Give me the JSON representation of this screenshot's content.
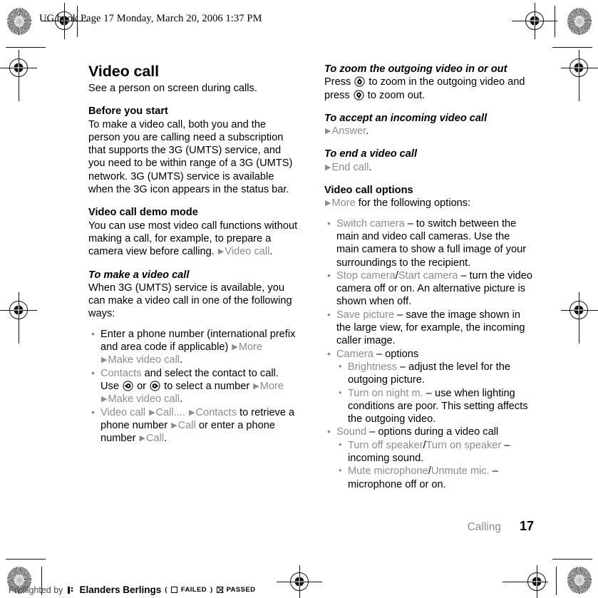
{
  "header": {
    "text": "UG.book  Page 17  Monday, March 20, 2006  1:37 PM"
  },
  "left_column": {
    "title": "Video call",
    "intro": "See a person on screen during calls.",
    "section_before": {
      "heading": "Before you start",
      "body": "To make a video call, both you and the person you are calling need a subscription that supports the 3G (UMTS) service, and you need to be within range of a 3G (UMTS) network. 3G (UMTS) service is available when the 3G icon appears in the status bar."
    },
    "section_demo": {
      "heading": "Video call demo mode",
      "body": "You can use most video call functions without making a call, for example, to prepare a camera view before calling.",
      "path_arrow": "▶",
      "path_keyword": "Video call",
      "path_end": "."
    },
    "section_make": {
      "heading": "To make a video call",
      "body": "When 3G (UMTS) service is available, you can make a video call in one of the following ways:",
      "bullets": [
        {
          "id": "enter-number",
          "parts": [
            {
              "t": "Enter a phone number (international prefix and area code if applicable) ",
              "s": "plain"
            },
            {
              "t": "▶",
              "s": "arrow"
            },
            {
              "t": "More",
              "s": "kw"
            },
            {
              "t": " ",
              "s": "plain"
            },
            {
              "t": "▶",
              "s": "arrow"
            },
            {
              "t": "Make video call",
              "s": "kw"
            },
            {
              "t": ".",
              "s": "plain"
            }
          ]
        },
        {
          "id": "contacts",
          "parts": [
            {
              "t": "Contacts",
              "s": "kw"
            },
            {
              "t": " and select the contact to call. Use ",
              "s": "plain"
            },
            {
              "t": "nav-left-key",
              "s": "icon-left"
            },
            {
              "t": " or ",
              "s": "plain"
            },
            {
              "t": "nav-right-key",
              "s": "icon-right"
            },
            {
              "t": " to select a number ",
              "s": "plain"
            },
            {
              "t": "▶",
              "s": "arrow"
            },
            {
              "t": "More",
              "s": "kw"
            },
            {
              "t": " ",
              "s": "plain"
            },
            {
              "t": "▶",
              "s": "arrow"
            },
            {
              "t": "Make video call",
              "s": "kw"
            },
            {
              "t": ".",
              "s": "plain"
            }
          ]
        },
        {
          "id": "video-call-menu",
          "parts": [
            {
              "t": "Video call",
              "s": "kw"
            },
            {
              "t": " ",
              "s": "plain"
            },
            {
              "t": "▶",
              "s": "arrow"
            },
            {
              "t": "Call....",
              "s": "kw"
            },
            {
              "t": " ",
              "s": "plain"
            },
            {
              "t": "▶",
              "s": "arrow"
            },
            {
              "t": "Contacts",
              "s": "kw"
            },
            {
              "t": " to retrieve a phone number ",
              "s": "plain"
            },
            {
              "t": "▶",
              "s": "arrow"
            },
            {
              "t": "Call",
              "s": "kw"
            },
            {
              "t": " or enter a phone number ",
              "s": "plain"
            },
            {
              "t": "▶",
              "s": "arrow"
            },
            {
              "t": "Call",
              "s": "kw"
            },
            {
              "t": ".",
              "s": "plain"
            }
          ]
        }
      ]
    }
  },
  "right_column": {
    "section_zoom": {
      "heading": "To zoom the outgoing video in or out",
      "parts": [
        {
          "t": "Press ",
          "s": "plain"
        },
        {
          "t": "nav-up-key",
          "s": "icon-up"
        },
        {
          "t": " to zoom in the outgoing video and press ",
          "s": "plain"
        },
        {
          "t": "nav-down-key",
          "s": "icon-down"
        },
        {
          "t": " to zoom out.",
          "s": "plain"
        }
      ]
    },
    "section_accept": {
      "heading": "To accept an incoming video call",
      "parts": [
        {
          "t": "▶",
          "s": "arrow"
        },
        {
          "t": "Answer",
          "s": "kw"
        },
        {
          "t": ".",
          "s": "plain"
        }
      ]
    },
    "section_end": {
      "heading": "To end a video call",
      "parts": [
        {
          "t": "▶",
          "s": "arrow"
        },
        {
          "t": "End call",
          "s": "kw"
        },
        {
          "t": ".",
          "s": "plain"
        }
      ]
    },
    "section_options": {
      "heading": "Video call options",
      "lead_parts": [
        {
          "t": "▶",
          "s": "arrow"
        },
        {
          "t": "More",
          "s": "kw"
        },
        {
          "t": " for the following options:",
          "s": "plain"
        }
      ],
      "bullets": [
        {
          "id": "switch-camera",
          "parts": [
            {
              "t": "Switch camera",
              "s": "kw"
            },
            {
              "t": " – to switch between the main and video call cameras. Use the main camera to show a full image of your surroundings to the recipient.",
              "s": "plain"
            }
          ]
        },
        {
          "id": "stop-start-camera",
          "parts": [
            {
              "t": "Stop camera",
              "s": "kw"
            },
            {
              "t": "/",
              "s": "plain"
            },
            {
              "t": "Start camera",
              "s": "kw"
            },
            {
              "t": " – turn the video camera off or on. An alternative picture is shown when off.",
              "s": "plain"
            }
          ]
        },
        {
          "id": "save-picture",
          "parts": [
            {
              "t": "Save picture",
              "s": "kw"
            },
            {
              "t": " – save the image shown in the large view, for example, the incoming caller image.",
              "s": "plain"
            }
          ]
        },
        {
          "id": "camera",
          "parts": [
            {
              "t": "Camera",
              "s": "kw"
            },
            {
              "t": " – options",
              "s": "plain"
            }
          ],
          "children": [
            {
              "id": "brightness",
              "parts": [
                {
                  "t": "Brightness",
                  "s": "kw"
                },
                {
                  "t": " – adjust the level for the outgoing picture.",
                  "s": "plain"
                }
              ]
            },
            {
              "id": "turn-on-night-mode",
              "parts": [
                {
                  "t": "Turn on night m.",
                  "s": "kw"
                },
                {
                  "t": " – use when lighting conditions are poor. This setting affects the outgoing video.",
                  "s": "plain"
                }
              ]
            }
          ]
        },
        {
          "id": "sound",
          "parts": [
            {
              "t": "Sound",
              "s": "kw"
            },
            {
              "t": " – options during a video call",
              "s": "plain"
            }
          ],
          "children": [
            {
              "id": "speaker-toggle",
              "parts": [
                {
                  "t": "Turn off speaker",
                  "s": "kw"
                },
                {
                  "t": "/",
                  "s": "plain"
                },
                {
                  "t": "Turn on speaker",
                  "s": "kw"
                },
                {
                  "t": " – incoming sound.",
                  "s": "plain"
                }
              ]
            },
            {
              "id": "microphone-toggle",
              "parts": [
                {
                  "t": "Mute microphone",
                  "s": "kw"
                },
                {
                  "t": "/",
                  "s": "plain"
                },
                {
                  "t": "Unmute mic.",
                  "s": "kw"
                },
                {
                  "t": " – microphone off or on.",
                  "s": "plain"
                }
              ]
            }
          ]
        }
      ]
    }
  },
  "footer": {
    "chapter": "Calling",
    "page_number": "17"
  },
  "preflight": {
    "by_label": "Preflighted by",
    "company": "Elanders Berlings",
    "failed_open": "(",
    "failed_label": "FAILED",
    "failed_close": ")",
    "passed_label": "PASSED"
  },
  "colors": {
    "keyword_gray": "#8c8c8c",
    "text_black": "#000000",
    "mark_black": "#111111"
  }
}
